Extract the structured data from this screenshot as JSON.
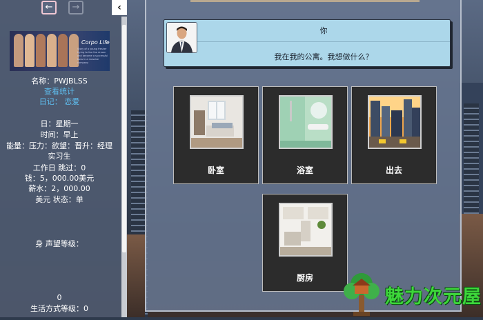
{
  "sidebar": {
    "banner": {
      "title": "Corpo Life",
      "sub": "Story of a young fresher trying to live the dream and become a successful boss in a massive company"
    },
    "name_line": "名称：PWJBLSS",
    "stats_link": "查看统计",
    "diary_label": "日记：",
    "diary_link": "恋爱",
    "day": "日：星期一",
    "time": "时间：早上",
    "status_line": "能量：压力：欲望：晋升：经理 实习生",
    "workday": "工作日 跳过：0",
    "money": "钱：5，000.00美元",
    "salary": "薪水：2，000.00",
    "state": "美元 状态：单",
    "reputation": "身 声望等级：",
    "zero": "0",
    "lifestyle": "生活方式等级：0"
  },
  "dialog": {
    "speaker": "你",
    "text": "我在我的公寓。我想做什么？"
  },
  "choices": [
    {
      "label": "卧室",
      "icon": "bedroom-thumbnail"
    },
    {
      "label": "浴室",
      "icon": "bathroom-thumbnail"
    },
    {
      "label": "出去",
      "icon": "city-street-thumbnail"
    },
    {
      "label": "厨房",
      "icon": "kitchen-thumbnail"
    }
  ],
  "watermark": {
    "text": "魅力次元屋"
  },
  "colors": {
    "link": "#5fc0f2",
    "dialog_bg": "#acd7ea",
    "card_bg": "#2c2c2c",
    "watermark": "#3dd63a"
  }
}
